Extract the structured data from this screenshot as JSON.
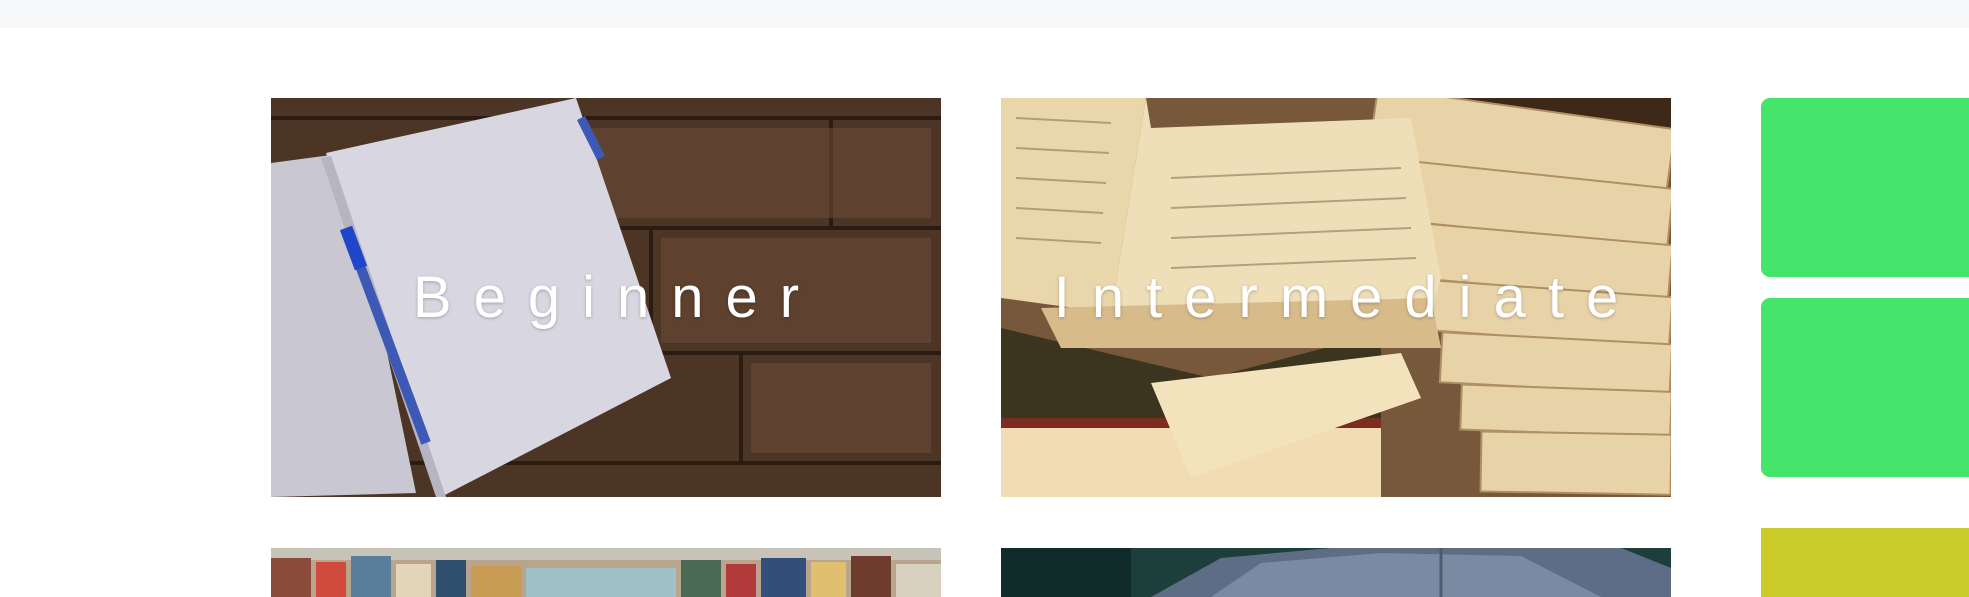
{
  "cards": {
    "beginner": {
      "label": "Beginner"
    },
    "intermediate": {
      "label": "Intermediate"
    }
  },
  "side_blocks": {
    "block_1": {
      "color": "#45e56b"
    },
    "block_2": {
      "color": "#45e56b"
    },
    "block_3": {
      "color": "#cbcb2a"
    }
  }
}
